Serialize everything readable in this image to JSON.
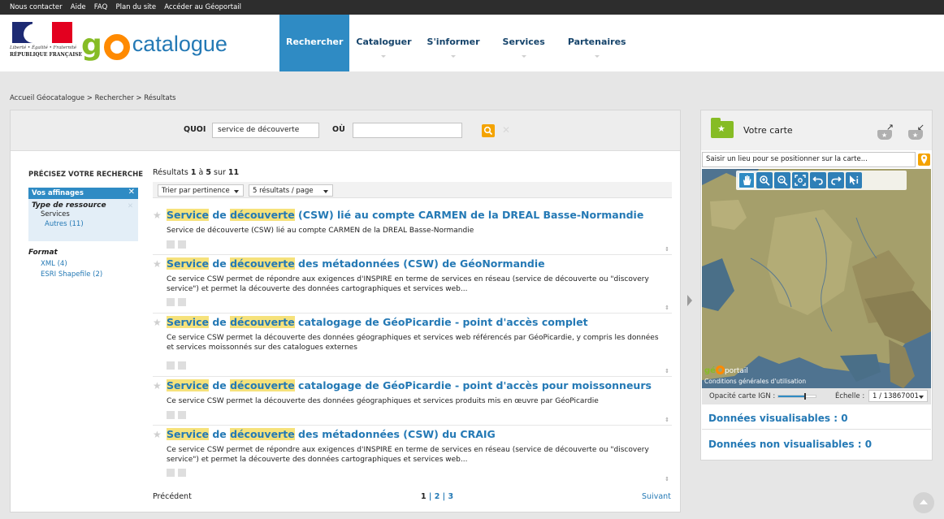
{
  "topbar": {
    "links": [
      "Nous contacter",
      "Aide",
      "FAQ",
      "Plan du site",
      "Accéder au Géoportail"
    ]
  },
  "header": {
    "motto": "Liberté • Égalité • Fraternité",
    "republic": "RÉPUBLIQUE FRANÇAISE",
    "logo_g": "g",
    "logo_catalogue": "catalogue",
    "nav": [
      "Rechercher",
      "Cataloguer",
      "S'informer",
      "Services",
      "Partenaires"
    ]
  },
  "breadcrumb": "Accueil Géocatalogue > Rechercher > Résultats",
  "search": {
    "quoi_label": "QUOI",
    "quoi_value": "service de découverte",
    "ou_label": "OÙ",
    "ou_value": "",
    "clear": "✕"
  },
  "facets": {
    "title": "PRÉCISEZ VOTRE RECHERCHE",
    "header": "Vos affinages",
    "header_close": "✕",
    "group1_title": "Type de ressource",
    "group1_value": "Services",
    "group1_close": "✕",
    "group1_link": "Autres (11)",
    "format_title": "Format",
    "format_items": [
      "XML (4)",
      "ESRI Shapefile (2)"
    ]
  },
  "results": {
    "count_prefix": "Résultats ",
    "count_from": "1",
    "count_mid": " à ",
    "count_to": "5",
    "count_sur": " sur ",
    "count_total": "11",
    "sort_label": "Trier par pertinence",
    "per_page_label": "5 résultats / page",
    "hl1": "Service",
    "hl2": "découverte",
    "items": [
      {
        "pre": "",
        "mid": " de ",
        "post": " (CSW) lié au compte CARMEN de la DREAL Basse-Normandie",
        "desc": "Service de découverte (CSW) lié au compte CARMEN de la DREAL Basse-Normandie"
      },
      {
        "pre": "",
        "mid": " de ",
        "post": " des métadonnées (CSW) de GéoNormandie",
        "desc": "Ce service CSW permet de répondre aux exigences d'INSPIRE en terme de services en réseau (service de découverte ou \"discovery service\") et permet la découverte des données cartographiques et services web..."
      },
      {
        "pre": "",
        "mid": " de ",
        "post": " catalogage de GéoPicardie - point d'accès complet",
        "desc": "Ce service CSW permet la découverte des données géographiques et services web référencés par GéoPicardie, y compris les données et services moissonnés sur des catalogues externes"
      },
      {
        "pre": "",
        "mid": " de ",
        "post": " catalogage de GéoPicardie - point d'accès pour moissonneurs",
        "desc": "Ce service CSW permet la découverte des données géographiques et services produits mis en œuvre par GéoPicardie"
      },
      {
        "pre": "",
        "mid": " de ",
        "post": " des métadonnées (CSW) du CRAIG",
        "desc": "Ce service CSW permet de répondre aux exigences d'INSPIRE en terme de services en réseau (service de découverte ou \"discovery service\") et permet la découverte des données cartographiques et services web..."
      }
    ],
    "more": "⇕"
  },
  "pagination": {
    "prev": "Précédent",
    "pages": [
      "1",
      "2",
      "3"
    ],
    "sep": " | ",
    "next": "Suivant"
  },
  "map": {
    "title": "Votre carte",
    "place_placeholder": "Saisir un lieu pour se positionner sur la carte...",
    "geoportail_g": "gé",
    "geoportail_rest": "portail",
    "cgu": "Conditions générales d'utilisation",
    "opacity_label": "Opacité carte IGN :",
    "opacity_value": 0.72,
    "scale_label": "Échelle :",
    "scale_value": "1 / 13867001",
    "visualisables": "Données visualisables :  0",
    "non_visualisables": "Données non visualisables : 0",
    "colors": {
      "land": "#a8a26a",
      "sea": "#4a6f88",
      "accent": "#2f8bc4",
      "orange": "#f4a300",
      "green": "#86bc25"
    }
  }
}
